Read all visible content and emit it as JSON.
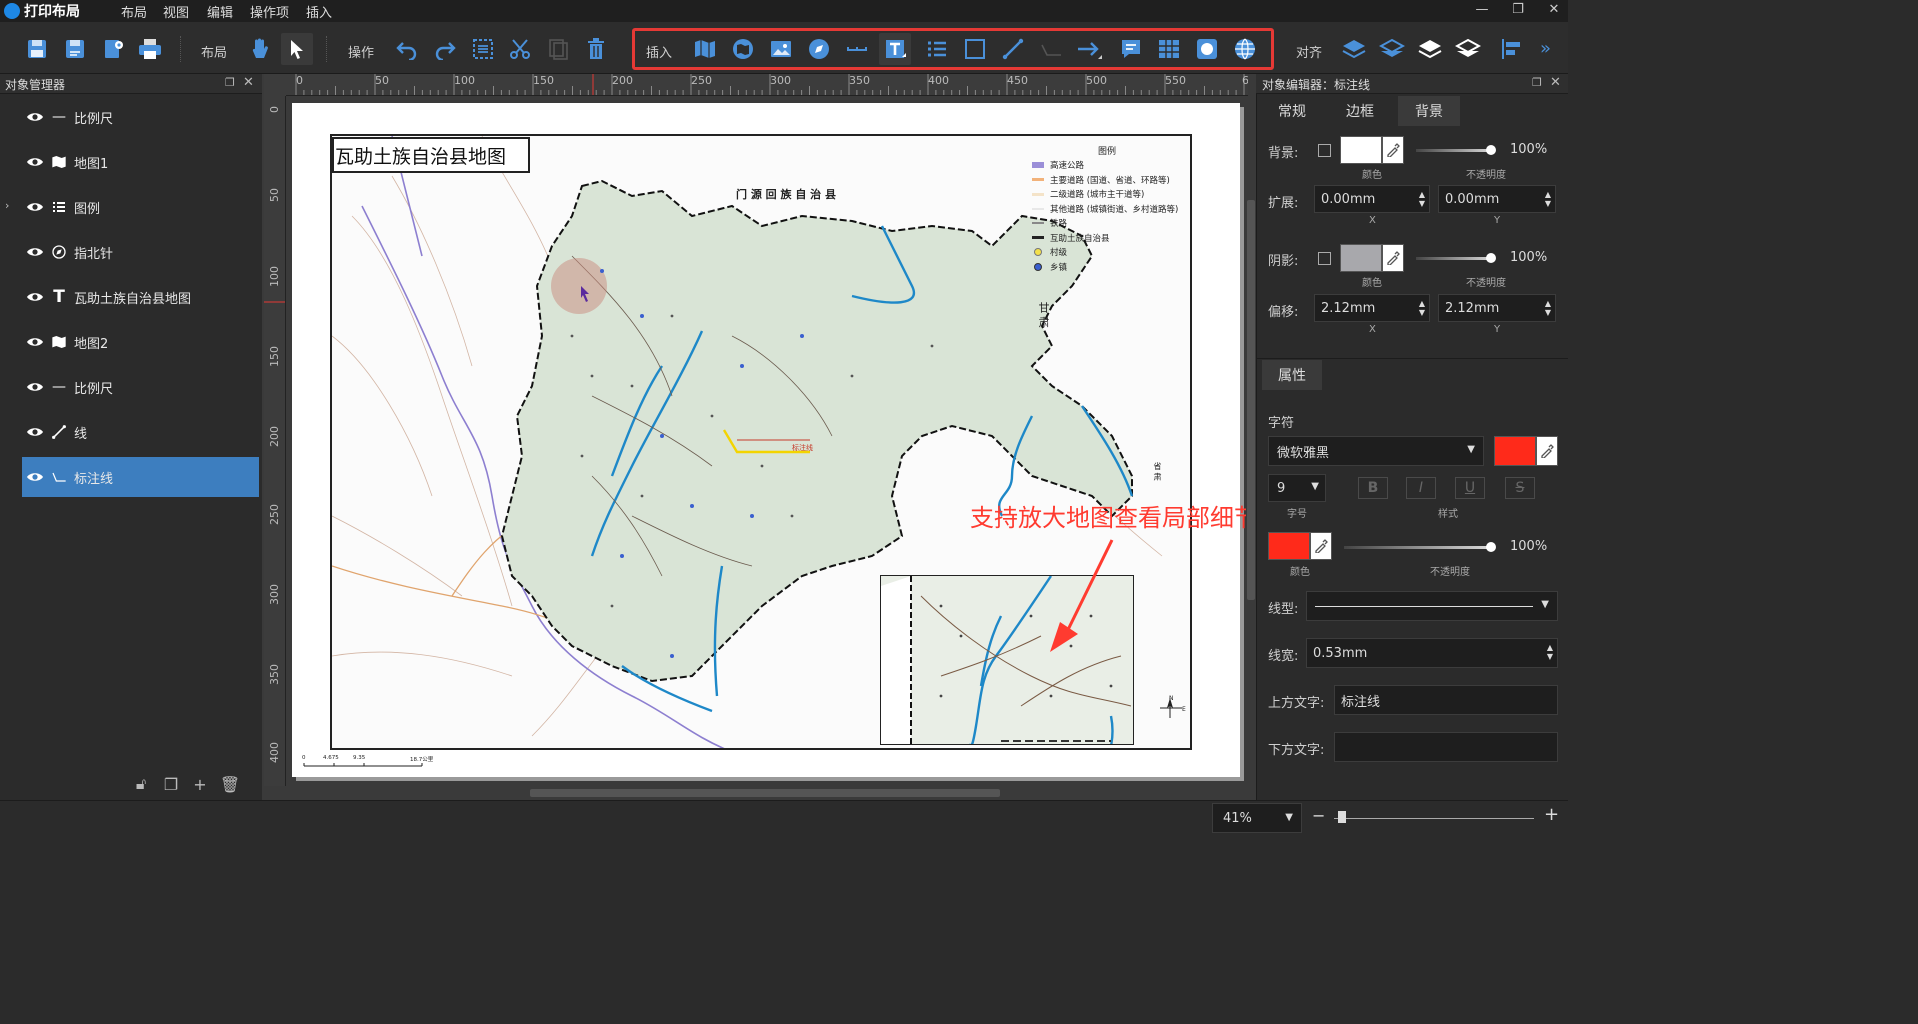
{
  "app": {
    "title": "打印布局",
    "menu": [
      "布局",
      "视图",
      "编辑",
      "操作项",
      "插入"
    ]
  },
  "toolbar": {
    "layout_label": "布局",
    "operate_label": "操作",
    "insert_label": "插入",
    "align_label": "对齐"
  },
  "object_manager": {
    "title": "对象管理器",
    "items": [
      {
        "label": "比例尺",
        "icon": "scale-bar-icon"
      },
      {
        "label": "地图1",
        "icon": "map-icon"
      },
      {
        "label": "图例",
        "icon": "legend-icon"
      },
      {
        "label": "指北针",
        "icon": "compass-icon"
      },
      {
        "label": "瓦助土族自治县地图",
        "icon": "text-icon"
      },
      {
        "label": "地图2",
        "icon": "map-icon"
      },
      {
        "label": "比例尺",
        "icon": "scale-bar-icon"
      },
      {
        "label": "线",
        "icon": "line-icon"
      },
      {
        "label": "标注线",
        "icon": "callout-line-icon"
      }
    ],
    "selected_index": 8
  },
  "rulers": {
    "top": [
      "0",
      "50",
      "100",
      "150",
      "200",
      "250",
      "300",
      "350",
      "400",
      "450",
      "500",
      "550",
      "6"
    ],
    "left": [
      "0",
      "50",
      "100",
      "150",
      "200",
      "250",
      "300",
      "350",
      "400"
    ]
  },
  "canvas": {
    "map_title": "瓦助土族自治县地图",
    "neighbor_label": "门 源 回 族 自 治 县",
    "side_label_1": "甘 肃",
    "side_label_2": "省 肃",
    "callout_text": "支持放大地图查看局部细节",
    "callout_small_label": "标注线",
    "legend": {
      "title": "图例",
      "items": [
        {
          "label": "高速公路",
          "color": "#9b8fd8"
        },
        {
          "label": "主要道路 (国道、省道、环路等)",
          "color": "#f2b27a"
        },
        {
          "label": "二级道路 (城市主干道等)",
          "color": "#f4e3c8"
        },
        {
          "label": "其他道路 (城镇街道、乡村道路等)",
          "color": "#e8e8e8"
        },
        {
          "label": "铁路",
          "color": "#888888"
        },
        {
          "label": "互助土族自治县",
          "color": "#222222"
        },
        {
          "label": "村级",
          "color": "#f3e04a"
        },
        {
          "label": "乡镇",
          "color": "#3a5fcf"
        }
      ]
    },
    "scale_ticks": [
      "0",
      "4.675",
      "9.35",
      "18.7公里"
    ]
  },
  "object_editor": {
    "title": "对象编辑器：标注线",
    "tabs": [
      "常规",
      "边框",
      "背景"
    ],
    "active_tab": 2,
    "background": {
      "label": "背景:",
      "checked": false,
      "color": "#ffffff",
      "color_caption": "颜色",
      "opacity": "100%",
      "opacity_caption": "不透明度"
    },
    "extend": {
      "label": "扩展:",
      "x": "0.00mm",
      "y": "0.00mm",
      "x_caption": "X",
      "y_caption": "Y"
    },
    "shadow": {
      "label": "阴影:",
      "checked": false,
      "color": "#a8a8ac",
      "color_caption": "颜色",
      "opacity": "100%",
      "opacity_caption": "不透明度"
    },
    "offset": {
      "label": "偏移:",
      "x": "2.12mm",
      "y": "2.12mm",
      "x_caption": "X",
      "y_caption": "Y"
    },
    "properties_title": "属性",
    "font": {
      "label": "字符",
      "family": "微软雅黑",
      "color": "#ff2a1a",
      "size": "9",
      "size_caption": "字号",
      "style_caption": "样式",
      "styles": [
        "B",
        "I",
        "U",
        "S"
      ]
    },
    "line_color": {
      "color": "#ff2a1a",
      "color_caption": "颜色",
      "opacity": "100%",
      "opacity_caption": "不透明度"
    },
    "line_type": {
      "label": "线型:"
    },
    "line_width": {
      "label": "线宽:",
      "value": "0.53mm"
    },
    "top_text": {
      "label": "上方文字:",
      "value": "标注线"
    },
    "bottom_text": {
      "label": "下方文字:",
      "value": ""
    }
  },
  "statusbar": {
    "zoom": "41%",
    "zoom_level": 0.41
  }
}
